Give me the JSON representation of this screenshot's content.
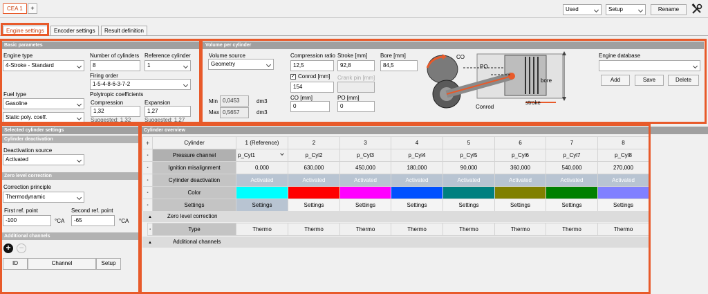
{
  "top_tabs": {
    "active": "CEA 1",
    "add": "+"
  },
  "toolbar": {
    "used": "Used",
    "setup": "Setup",
    "rename": "Rename",
    "tools_icon": "tools-icon"
  },
  "sub_tabs": [
    "Engine settings",
    "Encoder settings",
    "Result definition"
  ],
  "basic": {
    "header": "Basic parametes",
    "engine_type_label": "Engine type",
    "engine_type": "4-Stroke - Standard",
    "cyl_label": "Number of cylinders",
    "cyl": "8",
    "ref_label": "Reference cylinder",
    "ref": "1",
    "firing_label": "Firing order",
    "firing": "1-5-4-8-6-3-7-2",
    "fuel_label": "Fuel type",
    "fuel": "Gasoline",
    "poly_label": "Polytropic coefficients",
    "poly_mode": "Static poly. coeff.",
    "comp_label": "Compression",
    "comp": "1,32",
    "comp_sugg": "Suggested: 1.32",
    "exp_label": "Expansion",
    "exp": "1,27",
    "exp_sugg": "Suggested: 1.27"
  },
  "volume": {
    "header": "Volume per cylinder",
    "source_label": "Volume source",
    "source": "Geometry",
    "min_label": "Min",
    "min": "0,0453",
    "min_unit": "dm3",
    "max_label": "Max",
    "max": "0,5657",
    "max_unit": "dm3",
    "cr_label": "Compression ratio",
    "cr": "12,5",
    "stroke_label": "Stroke [mm]",
    "stroke": "92,8",
    "bore_label": "Bore [mm]",
    "bore": "84,5",
    "conrod_label": "Conrod [mm]",
    "conrod": "154",
    "crankpin_label": "Crank pin [mm]",
    "co_label": "CO [mm]",
    "co": "0",
    "po_label": "PO [mm]",
    "po": "0",
    "diag_co": "CO",
    "diag_po": "PO",
    "diag_bore": "bore",
    "diag_stroke": "stroke",
    "diag_conrod": "Conrod",
    "db_label": "Engine database",
    "add": "Add",
    "save": "Save",
    "delete": "Delete"
  },
  "selected": {
    "header": "Selected cylinder settings",
    "deact_header": "Cylinder deactivation",
    "deact_src_label": "Deactivation source",
    "deact_src": "Activated",
    "zero_header": "Zero level correction",
    "principle_label": "Correction principle",
    "principle": "Thermodynamic",
    "first_label": "First ref. point",
    "first": "-100",
    "first_unit": "°CA",
    "second_label": "Second ref. point",
    "second": "-65",
    "second_unit": "°CA",
    "add_header": "Additional channels",
    "cols": [
      "ID",
      "Channel",
      "Setup"
    ]
  },
  "overview": {
    "header": "Cylinder overview",
    "plus": "+",
    "cyl_col": "Cylinder",
    "cylinders": [
      "1 (Reference)",
      "2",
      "3",
      "4",
      "5",
      "6",
      "7",
      "8"
    ],
    "rows": {
      "pressure": "Pressure channel",
      "ignition": "Ignition misalignment",
      "deact": "Cylinder deactivation",
      "color": "Color",
      "settings": "Settings"
    },
    "pressure": [
      "p_Cyl1",
      "p_Cyl2",
      "p_Cyl3",
      "p_Cyl4",
      "p_Cyl5",
      "p_Cyl6",
      "p_Cyl7",
      "p_Cyl8"
    ],
    "ignition": [
      "0,000",
      "630,000",
      "450,000",
      "180,000",
      "90,000",
      "360,000",
      "540,000",
      "270,000"
    ],
    "deact": [
      "Activated",
      "Activated",
      "Activated",
      "Activated",
      "Activated",
      "Activated",
      "Activated",
      "Activated"
    ],
    "colors": [
      "#00ffff",
      "#ff0000",
      "#ff00ff",
      "#0050ff",
      "#008080",
      "#808000",
      "#008000",
      "#8080ff"
    ],
    "settings": [
      "Settings",
      "Settings",
      "Settings",
      "Settings",
      "Settings",
      "Settings",
      "Settings",
      "Settings"
    ],
    "zero_section": "Zero level correction",
    "type_label": "Type",
    "types": [
      "Thermo",
      "Thermo",
      "Thermo",
      "Thermo",
      "Thermo",
      "Thermo",
      "Thermo",
      "Thermo"
    ],
    "add_section": "Additional channels"
  }
}
